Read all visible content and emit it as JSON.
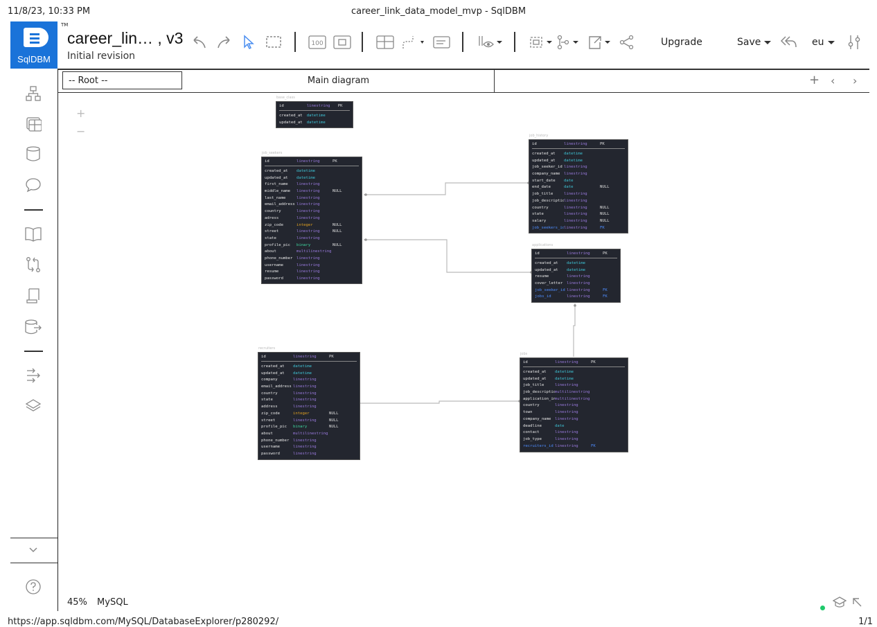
{
  "print": {
    "datetime": "11/8/23, 10:33 PM",
    "title": "career_link_data_model_mvp - SqlDBM",
    "url": "https://app.sqldbm.com/MySQL/DatabaseExplorer/p280292/",
    "page": "1/1"
  },
  "brand": {
    "name": "SqlDBM",
    "tm": "TM",
    "color": "#1a73d9"
  },
  "project": {
    "title": "career_lin… , v3",
    "subtitle": "Initial revision"
  },
  "toolbar": {
    "upgrade_label": "Upgrade",
    "save_label": "Save",
    "region_label": "eu",
    "zoom_100": "100"
  },
  "tabs": {
    "root": "-- Root --",
    "main": "Main diagram"
  },
  "status": {
    "zoom": "45%",
    "db": "MySQL"
  },
  "sidebar_icons": [
    "diagram-tree-icon",
    "table-icon",
    "database-icon",
    "comment-icon",
    "book-icon",
    "compare-icon",
    "document-icon",
    "db-export-icon",
    "flow-icon",
    "layers-icon",
    "chevron-down-icon",
    "help-icon"
  ],
  "diagram": {
    "tables": {
      "base_class": {
        "name": "base_class",
        "rows": [
          {
            "n": "id",
            "t": "linestring",
            "k": "PK"
          },
          {
            "n": "created_at",
            "t": "datetime",
            "k": ""
          },
          {
            "n": "updated_at",
            "t": "datetime",
            "k": ""
          }
        ]
      },
      "job_seekers": {
        "name": "job_seekers",
        "rows": [
          {
            "n": "id",
            "t": "linestring",
            "k": "PK"
          },
          {
            "n": "created_at",
            "t": "datetime",
            "k": ""
          },
          {
            "n": "updated_at",
            "t": "datetime",
            "k": ""
          },
          {
            "n": "first_name",
            "t": "linestring",
            "k": ""
          },
          {
            "n": "middle_name",
            "t": "linestring",
            "k": "NULL"
          },
          {
            "n": "last_name",
            "t": "linestring",
            "k": ""
          },
          {
            "n": "email_address",
            "t": "linestring",
            "k": ""
          },
          {
            "n": "country",
            "t": "linestring",
            "k": ""
          },
          {
            "n": "adress",
            "t": "linestring",
            "k": ""
          },
          {
            "n": "zip_code",
            "t": "integer",
            "k": "NULL"
          },
          {
            "n": "street",
            "t": "linestring",
            "k": "NULL"
          },
          {
            "n": "state",
            "t": "linestring",
            "k": ""
          },
          {
            "n": "profile_pic",
            "t": "binary",
            "k": "NULL"
          },
          {
            "n": "about",
            "t": "multilinestring",
            "k": ""
          },
          {
            "n": "phone_number",
            "t": "linestring",
            "k": ""
          },
          {
            "n": "username",
            "t": "linestring",
            "k": ""
          },
          {
            "n": "resume",
            "t": "linestring",
            "k": ""
          },
          {
            "n": "password",
            "t": "linestring",
            "k": ""
          }
        ]
      },
      "job_history": {
        "name": "job_history",
        "rows": [
          {
            "n": "id",
            "t": "linestring",
            "k": "PK"
          },
          {
            "n": "created_at",
            "t": "datetime",
            "k": ""
          },
          {
            "n": "updated_at",
            "t": "datetime",
            "k": ""
          },
          {
            "n": "job_seeker_id",
            "t": "linestring",
            "k": ""
          },
          {
            "n": "company_name",
            "t": "linestring",
            "k": ""
          },
          {
            "n": "start_date",
            "t": "date",
            "k": ""
          },
          {
            "n": "end_date",
            "t": "date",
            "k": "NULL"
          },
          {
            "n": "job_title",
            "t": "linestring",
            "k": ""
          },
          {
            "n": "job_description",
            "t": "linestring",
            "k": ""
          },
          {
            "n": "country",
            "t": "linestring",
            "k": "NULL"
          },
          {
            "n": "state",
            "t": "linestring",
            "k": "NULL"
          },
          {
            "n": "salary",
            "t": "linestring",
            "k": "NULL"
          },
          {
            "n": "job_seekers_id",
            "t": "linestring",
            "k": "FK"
          }
        ]
      },
      "applications": {
        "name": "applications",
        "rows": [
          {
            "n": "id",
            "t": "linestring",
            "k": "PK"
          },
          {
            "n": "created_at",
            "t": "datetime",
            "k": ""
          },
          {
            "n": "updated_at",
            "t": "datetime",
            "k": ""
          },
          {
            "n": "resume",
            "t": "linestring",
            "k": ""
          },
          {
            "n": "cover_letter",
            "t": "linestring",
            "k": ""
          },
          {
            "n": "job_seeker_id",
            "t": "linestring",
            "k": "FK"
          },
          {
            "n": "jobs_id",
            "t": "linestring",
            "k": "FK"
          }
        ]
      },
      "recruiters": {
        "name": "recruiters",
        "rows": [
          {
            "n": "id",
            "t": "linestring",
            "k": "PK"
          },
          {
            "n": "created_at",
            "t": "datetime",
            "k": ""
          },
          {
            "n": "updated_at",
            "t": "datetime",
            "k": ""
          },
          {
            "n": "company",
            "t": "linestring",
            "k": ""
          },
          {
            "n": "email_address",
            "t": "linestring",
            "k": ""
          },
          {
            "n": "country",
            "t": "linestring",
            "k": ""
          },
          {
            "n": "state",
            "t": "linestring",
            "k": ""
          },
          {
            "n": "address",
            "t": "linestring",
            "k": ""
          },
          {
            "n": "zip_code",
            "t": "integer",
            "k": "NULL"
          },
          {
            "n": "street",
            "t": "linestring",
            "k": "NULL"
          },
          {
            "n": "profile_pic",
            "t": "binary",
            "k": "NULL"
          },
          {
            "n": "about",
            "t": "multilinestring",
            "k": ""
          },
          {
            "n": "phone_number",
            "t": "linestring",
            "k": ""
          },
          {
            "n": "username",
            "t": "linestring",
            "k": ""
          },
          {
            "n": "password",
            "t": "linestring",
            "k": ""
          }
        ]
      },
      "jobs": {
        "name": "jobs",
        "rows": [
          {
            "n": "id",
            "t": "linestring",
            "k": "PK"
          },
          {
            "n": "created_at",
            "t": "datetime",
            "k": ""
          },
          {
            "n": "updated_at",
            "t": "datetime",
            "k": ""
          },
          {
            "n": "job_title",
            "t": "linestring",
            "k": ""
          },
          {
            "n": "job_description",
            "t": "multilinestring",
            "k": ""
          },
          {
            "n": "application_instr",
            "t": "multilinestring",
            "k": ""
          },
          {
            "n": "country",
            "t": "linestring",
            "k": ""
          },
          {
            "n": "town",
            "t": "linestring",
            "k": ""
          },
          {
            "n": "company_name",
            "t": "linestring",
            "k": ""
          },
          {
            "n": "deadline",
            "t": "date",
            "k": ""
          },
          {
            "n": "contact",
            "t": "linestring",
            "k": ""
          },
          {
            "n": "job_type",
            "t": "linestring",
            "k": ""
          },
          {
            "n": "recruiters_id",
            "t": "linestring",
            "k": "FK"
          }
        ]
      }
    }
  }
}
